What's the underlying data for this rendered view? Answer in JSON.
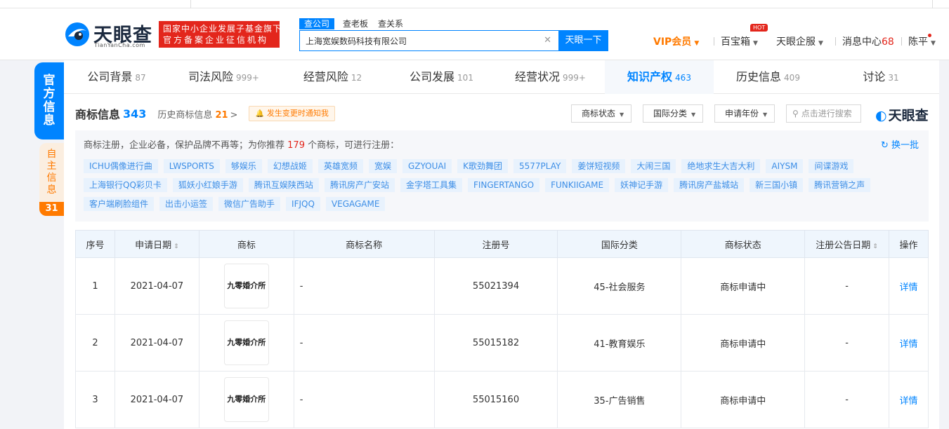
{
  "header": {
    "logo_text": "天眼查",
    "logo_sub": "TianYanCha.com",
    "badge_line1": "国家中小企业发展子基金旗下",
    "badge_line2": "官方备案企业征信机构",
    "search_tabs": [
      "查公司",
      "查老板",
      "查关系"
    ],
    "search_value": "上海宽娱数码科技有限公司",
    "search_button": "天眼一下",
    "vip": "VIP会员",
    "baobao": "百宝箱",
    "hot": "HOT",
    "enterprise": "天眼企服",
    "messages_label": "消息中心",
    "messages_count": "68",
    "user": "陈平"
  },
  "side": {
    "official": [
      "官",
      "方",
      "信",
      "息"
    ],
    "self": [
      "自",
      "主",
      "信",
      "息"
    ],
    "self_count": "31"
  },
  "nav_tabs": [
    {
      "label": "公司背景",
      "count": "87"
    },
    {
      "label": "司法风险",
      "count": "999+"
    },
    {
      "label": "经营风险",
      "count": "12"
    },
    {
      "label": "公司发展",
      "count": "101"
    },
    {
      "label": "经营状况",
      "count": "999+"
    },
    {
      "label": "知识产权",
      "count": "463"
    },
    {
      "label": "历史信息",
      "count": "409"
    },
    {
      "label": "讨论",
      "count": "31"
    }
  ],
  "section": {
    "title": "商标信息",
    "count": "343",
    "history_label": "历史商标信息",
    "history_count": "21",
    "history_chevron": ">",
    "notify": "发生变更时通知我"
  },
  "filters": {
    "status": "商标状态",
    "intl": "国际分类",
    "year": "申请年份",
    "search_placeholder": "点击进行搜索",
    "brand": "天眼查"
  },
  "recommend": {
    "text_prefix": "商标注册，企业必备，保护品牌不再等；为你推荐",
    "num": "179",
    "text_suffix": "个商标，可进行注册：",
    "refresh": "换一批",
    "chips": [
      "ICHU偶像进行曲",
      "LWSPORTS",
      "够娱乐",
      "幻想战姬",
      "英雄宽频",
      "宽娱",
      "GZYOUAI",
      "K歌劲舞团",
      "5577PLAY",
      "姜饼短视频",
      "大闹三国",
      "绝地求生大吉大利",
      "AIYSM",
      "间谍游戏",
      "上海银行QQ彩贝卡",
      "狐妖小红娘手游",
      "腾讯互娱陕西站",
      "腾讯房产广安站",
      "金字塔工具集",
      "FINGERTANGO",
      "FUNKIIGAME",
      "妖神记手游",
      "腾讯房产盐城站",
      "新三国小镇",
      "腾讯营销之声",
      "客户端刷脸组件",
      "出击小运签",
      "微信广告助手",
      "IFJQQ",
      "VEGAGAME"
    ]
  },
  "table": {
    "headers": [
      "序号",
      "申请日期",
      "商标",
      "商标名称",
      "注册号",
      "国际分类",
      "商标状态",
      "注册公告日期",
      "操作"
    ],
    "rows": [
      {
        "index": "1",
        "date": "2021-04-07",
        "mark": "九零婚介所",
        "name": "-",
        "reg_no": "55021394",
        "class": "45-社会服务",
        "status": "商标申请中",
        "notice_date": "-",
        "action": "详情"
      },
      {
        "index": "2",
        "date": "2021-04-07",
        "mark": "九零婚介所",
        "name": "-",
        "reg_no": "55015182",
        "class": "41-教育娱乐",
        "status": "商标申请中",
        "notice_date": "-",
        "action": "详情"
      },
      {
        "index": "3",
        "date": "2021-04-07",
        "mark": "九零婚介所",
        "name": "-",
        "reg_no": "55015160",
        "class": "35-广告销售",
        "status": "商标申请中",
        "notice_date": "-",
        "action": "详情"
      }
    ]
  }
}
